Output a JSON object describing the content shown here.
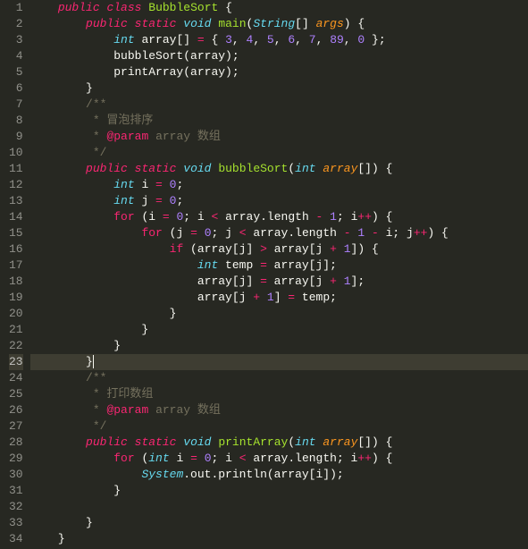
{
  "lines": [
    {
      "n": 1,
      "tokens": [
        [
          "    ",
          null
        ],
        [
          "public",
          "kw"
        ],
        [
          " ",
          null
        ],
        [
          "class",
          "kw"
        ],
        [
          " ",
          null
        ],
        [
          "BubbleSort",
          "cls"
        ],
        [
          " {",
          null
        ]
      ]
    },
    {
      "n": 2,
      "tokens": [
        [
          "        ",
          null
        ],
        [
          "public",
          "kw"
        ],
        [
          " ",
          null
        ],
        [
          "static",
          "kw"
        ],
        [
          " ",
          null
        ],
        [
          "void",
          "type"
        ],
        [
          " ",
          null
        ],
        [
          "main",
          "fn"
        ],
        [
          "(",
          null
        ],
        [
          "String",
          "type"
        ],
        [
          "[] ",
          null
        ],
        [
          "args",
          "param"
        ],
        [
          ") {",
          null
        ]
      ]
    },
    {
      "n": 3,
      "tokens": [
        [
          "            ",
          null
        ],
        [
          "int",
          "type"
        ],
        [
          " array[] ",
          null
        ],
        [
          "=",
          "op"
        ],
        [
          " { ",
          null
        ],
        [
          "3",
          "num"
        ],
        [
          ", ",
          null
        ],
        [
          "4",
          "num"
        ],
        [
          ", ",
          null
        ],
        [
          "5",
          "num"
        ],
        [
          ", ",
          null
        ],
        [
          "6",
          "num"
        ],
        [
          ", ",
          null
        ],
        [
          "7",
          "num"
        ],
        [
          ", ",
          null
        ],
        [
          "89",
          "num"
        ],
        [
          ", ",
          null
        ],
        [
          "0",
          "num"
        ],
        [
          " };",
          null
        ]
      ]
    },
    {
      "n": 4,
      "tokens": [
        [
          "            bubbleSort(array);",
          null
        ]
      ]
    },
    {
      "n": 5,
      "tokens": [
        [
          "            printArray(array);",
          null
        ]
      ]
    },
    {
      "n": 6,
      "tokens": [
        [
          "        }",
          null
        ]
      ]
    },
    {
      "n": 7,
      "tokens": [
        [
          "        ",
          null
        ],
        [
          "/**",
          "cmt"
        ]
      ]
    },
    {
      "n": 8,
      "tokens": [
        [
          "         * 冒泡排序",
          "cmt"
        ]
      ]
    },
    {
      "n": 9,
      "tokens": [
        [
          "         * ",
          "cmt"
        ],
        [
          "@param",
          "doc-tag"
        ],
        [
          " ",
          "cmt"
        ],
        [
          "array",
          "cmt"
        ],
        [
          " 数组",
          "cmt"
        ]
      ]
    },
    {
      "n": 10,
      "tokens": [
        [
          "         */",
          "cmt"
        ]
      ]
    },
    {
      "n": 11,
      "tokens": [
        [
          "        ",
          null
        ],
        [
          "public",
          "kw"
        ],
        [
          " ",
          null
        ],
        [
          "static",
          "kw"
        ],
        [
          " ",
          null
        ],
        [
          "void",
          "type"
        ],
        [
          " ",
          null
        ],
        [
          "bubbleSort",
          "fn"
        ],
        [
          "(",
          null
        ],
        [
          "int",
          "type"
        ],
        [
          " ",
          null
        ],
        [
          "array",
          "param"
        ],
        [
          "[]) {",
          null
        ]
      ]
    },
    {
      "n": 12,
      "tokens": [
        [
          "            ",
          null
        ],
        [
          "int",
          "type"
        ],
        [
          " i ",
          null
        ],
        [
          "=",
          "op"
        ],
        [
          " ",
          null
        ],
        [
          "0",
          "num"
        ],
        [
          ";",
          null
        ]
      ]
    },
    {
      "n": 13,
      "tokens": [
        [
          "            ",
          null
        ],
        [
          "int",
          "type"
        ],
        [
          " j ",
          null
        ],
        [
          "=",
          "op"
        ],
        [
          " ",
          null
        ],
        [
          "0",
          "num"
        ],
        [
          ";",
          null
        ]
      ]
    },
    {
      "n": 14,
      "tokens": [
        [
          "            ",
          null
        ],
        [
          "for",
          "kw2"
        ],
        [
          " (i ",
          null
        ],
        [
          "=",
          "op"
        ],
        [
          " ",
          null
        ],
        [
          "0",
          "num"
        ],
        [
          "; i ",
          null
        ],
        [
          "<",
          "op"
        ],
        [
          " array.length ",
          null
        ],
        [
          "-",
          "op"
        ],
        [
          " ",
          null
        ],
        [
          "1",
          "num"
        ],
        [
          "; i",
          null
        ],
        [
          "++",
          "op"
        ],
        [
          ") {",
          null
        ]
      ]
    },
    {
      "n": 15,
      "tokens": [
        [
          "                ",
          null
        ],
        [
          "for",
          "kw2"
        ],
        [
          " (j ",
          null
        ],
        [
          "=",
          "op"
        ],
        [
          " ",
          null
        ],
        [
          "0",
          "num"
        ],
        [
          "; j ",
          null
        ],
        [
          "<",
          "op"
        ],
        [
          " array.length ",
          null
        ],
        [
          "-",
          "op"
        ],
        [
          " ",
          null
        ],
        [
          "1",
          "num"
        ],
        [
          " ",
          null
        ],
        [
          "-",
          "op"
        ],
        [
          " i; j",
          null
        ],
        [
          "++",
          "op"
        ],
        [
          ") {",
          null
        ]
      ]
    },
    {
      "n": 16,
      "tokens": [
        [
          "                    ",
          null
        ],
        [
          "if",
          "kw2"
        ],
        [
          " (array[j] ",
          null
        ],
        [
          ">",
          "op"
        ],
        [
          " array[j ",
          null
        ],
        [
          "+",
          "op"
        ],
        [
          " ",
          null
        ],
        [
          "1",
          "num"
        ],
        [
          "]) {",
          null
        ]
      ]
    },
    {
      "n": 17,
      "tokens": [
        [
          "                        ",
          null
        ],
        [
          "int",
          "type"
        ],
        [
          " temp ",
          null
        ],
        [
          "=",
          "op"
        ],
        [
          " array[j];",
          null
        ]
      ]
    },
    {
      "n": 18,
      "tokens": [
        [
          "                        array[j] ",
          null
        ],
        [
          "=",
          "op"
        ],
        [
          " array[j ",
          null
        ],
        [
          "+",
          "op"
        ],
        [
          " ",
          null
        ],
        [
          "1",
          "num"
        ],
        [
          "];",
          null
        ]
      ]
    },
    {
      "n": 19,
      "tokens": [
        [
          "                        array[j ",
          null
        ],
        [
          "+",
          "op"
        ],
        [
          " ",
          null
        ],
        [
          "1",
          "num"
        ],
        [
          "] ",
          null
        ],
        [
          "=",
          "op"
        ],
        [
          " temp;",
          null
        ]
      ]
    },
    {
      "n": 20,
      "tokens": [
        [
          "                    }",
          null
        ]
      ]
    },
    {
      "n": 21,
      "tokens": [
        [
          "                }",
          null
        ]
      ]
    },
    {
      "n": 22,
      "tokens": [
        [
          "            }",
          null
        ]
      ]
    },
    {
      "n": 23,
      "hl": true,
      "cursor": true,
      "tokens": [
        [
          "        }",
          null
        ]
      ]
    },
    {
      "n": 24,
      "tokens": [
        [
          "        ",
          null
        ],
        [
          "/**",
          "cmt"
        ]
      ]
    },
    {
      "n": 25,
      "tokens": [
        [
          "         * 打印数组",
          "cmt"
        ]
      ]
    },
    {
      "n": 26,
      "tokens": [
        [
          "         * ",
          "cmt"
        ],
        [
          "@param",
          "doc-tag"
        ],
        [
          " ",
          "cmt"
        ],
        [
          "array",
          "cmt"
        ],
        [
          " 数组",
          "cmt"
        ]
      ]
    },
    {
      "n": 27,
      "tokens": [
        [
          "         */",
          "cmt"
        ]
      ]
    },
    {
      "n": 28,
      "tokens": [
        [
          "        ",
          null
        ],
        [
          "public",
          "kw"
        ],
        [
          " ",
          null
        ],
        [
          "static",
          "kw"
        ],
        [
          " ",
          null
        ],
        [
          "void",
          "type"
        ],
        [
          " ",
          null
        ],
        [
          "printArray",
          "fn"
        ],
        [
          "(",
          null
        ],
        [
          "int",
          "type"
        ],
        [
          " ",
          null
        ],
        [
          "array",
          "param"
        ],
        [
          "[]) {",
          null
        ]
      ]
    },
    {
      "n": 29,
      "tokens": [
        [
          "            ",
          null
        ],
        [
          "for",
          "kw2"
        ],
        [
          " (",
          null
        ],
        [
          "int",
          "type"
        ],
        [
          " i ",
          null
        ],
        [
          "=",
          "op"
        ],
        [
          " ",
          null
        ],
        [
          "0",
          "num"
        ],
        [
          "; i ",
          null
        ],
        [
          "<",
          "op"
        ],
        [
          " array.length; i",
          null
        ],
        [
          "++",
          "op"
        ],
        [
          ") {",
          null
        ]
      ]
    },
    {
      "n": 30,
      "tokens": [
        [
          "                ",
          null
        ],
        [
          "System",
          "sys"
        ],
        [
          ".out.println(array[i]);",
          null
        ]
      ]
    },
    {
      "n": 31,
      "tokens": [
        [
          "            }",
          null
        ]
      ]
    },
    {
      "n": 32,
      "tokens": [
        [
          "",
          null
        ]
      ]
    },
    {
      "n": 33,
      "tokens": [
        [
          "        }",
          null
        ]
      ]
    },
    {
      "n": 34,
      "tokens": [
        [
          "    }",
          null
        ]
      ]
    }
  ]
}
